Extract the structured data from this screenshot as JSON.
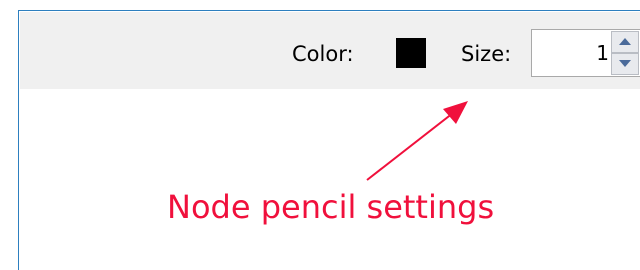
{
  "toolbar": {
    "color_label": "Color:",
    "color_value": "#000000",
    "size_label": "Size:",
    "size_value": "1"
  },
  "annotation": {
    "text": "Node pencil settings",
    "color": "#f0103c"
  },
  "icons": {
    "spin_up": "arrow-up-icon",
    "spin_down": "arrow-down-icon"
  }
}
